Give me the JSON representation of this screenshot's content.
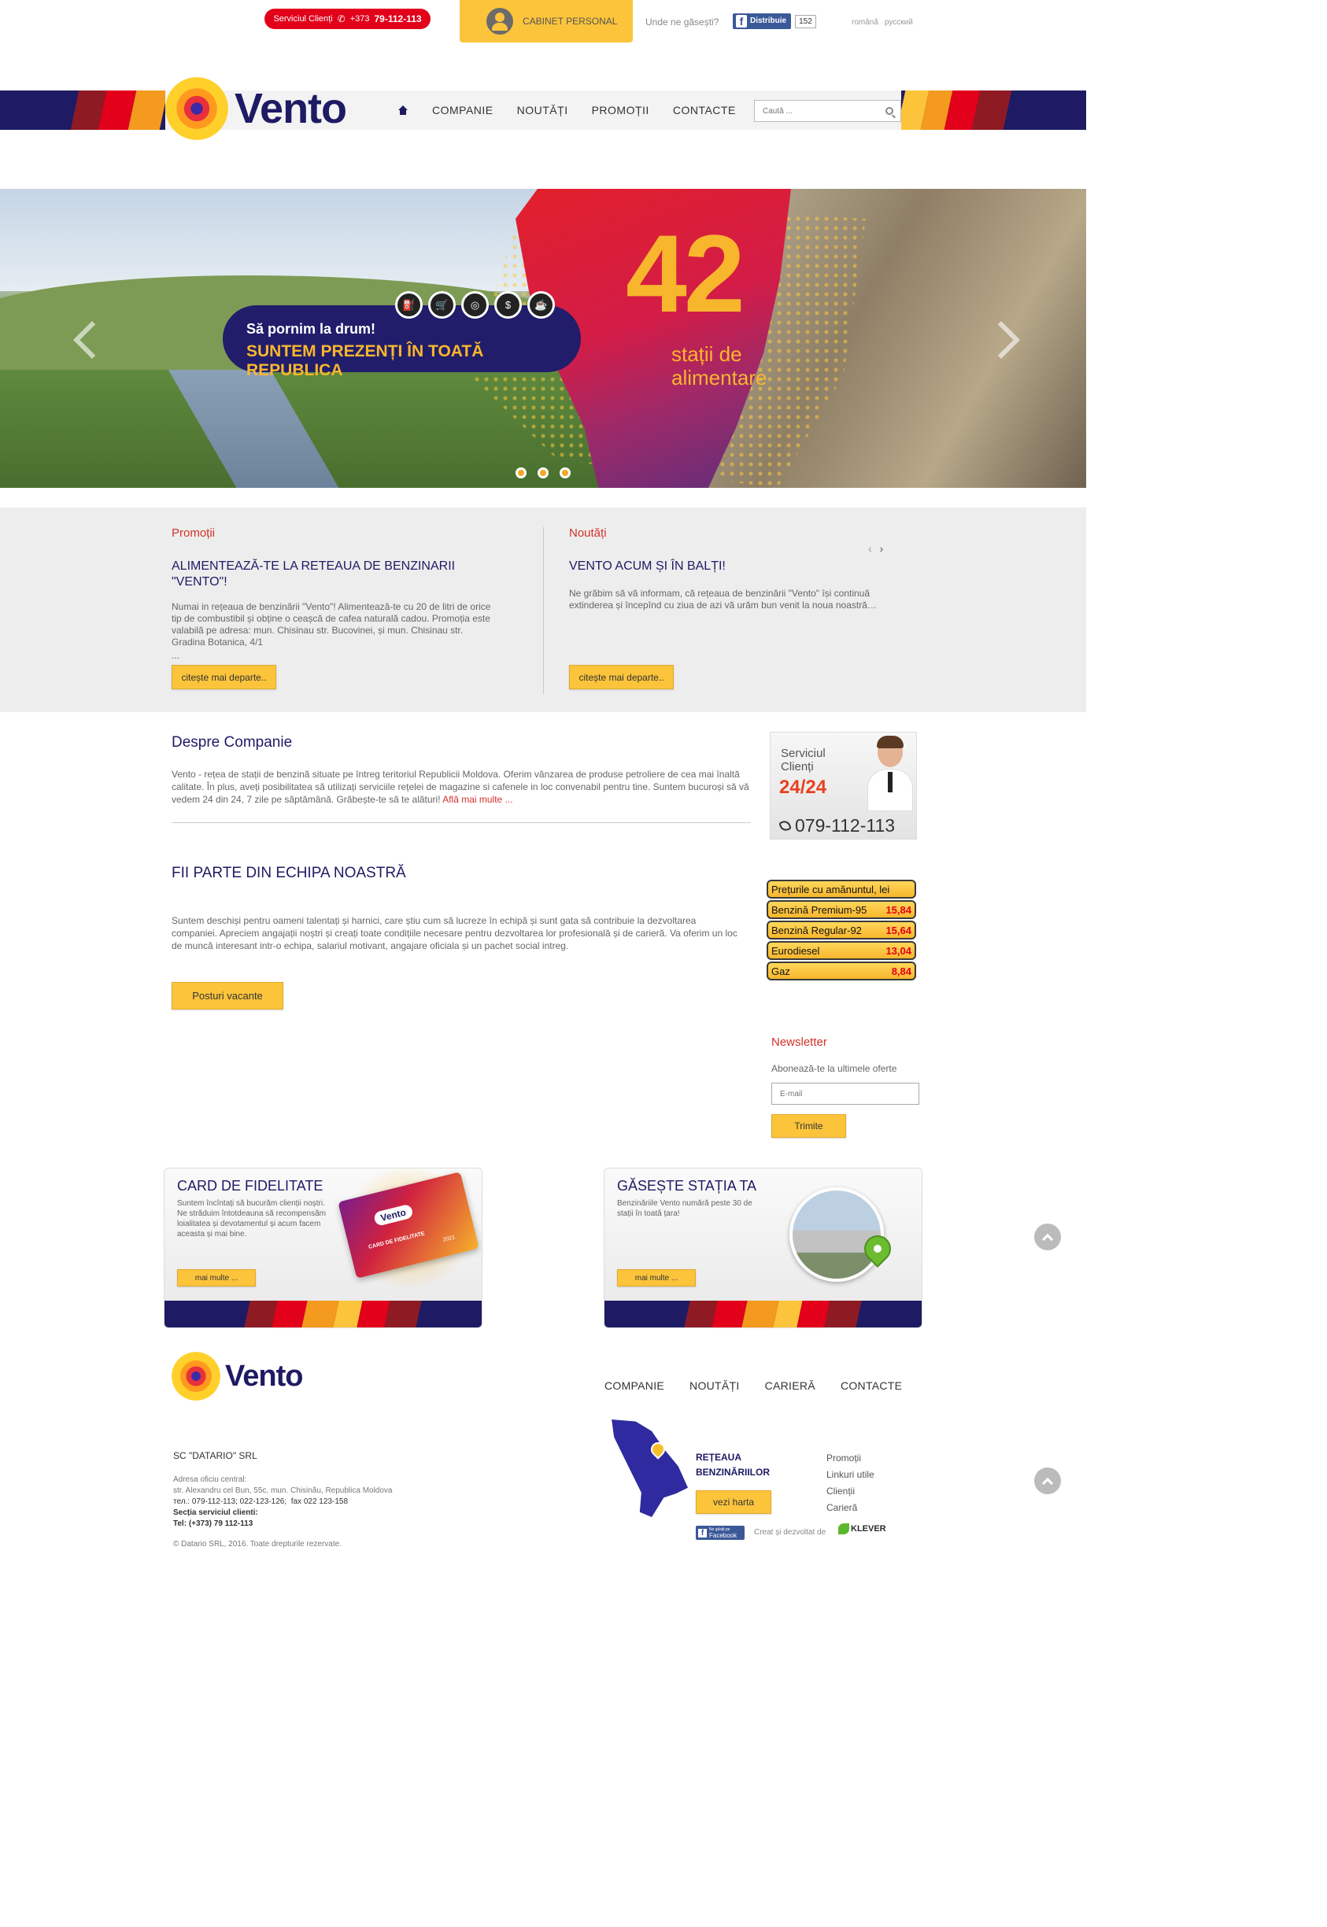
{
  "topbar": {
    "service_label": "Serviciul Clienți",
    "service_phone_prefix": "+373",
    "service_phone": "79-112-113",
    "cabinet_label": "CABINET PERSONAL",
    "find_label": "Unde ne găsești?",
    "fb_label": "Distribuie",
    "fb_count": "152",
    "lang_ro": "română",
    "lang_ru": "русский"
  },
  "nav": {
    "logo_text": "Vento",
    "items": [
      "COMPANIE",
      "NOUTĂȚI",
      "PROMOȚII",
      "CONTACTE"
    ],
    "search_placeholder": "Caută ..."
  },
  "hero": {
    "pill_line1": "Să pornim la drum!",
    "pill_line2": "SUNTEM PREZENȚI ÎN TOATĂ REPUBLICA",
    "big_number": "42",
    "big_sub1": "stații de",
    "big_sub2": "alimentare",
    "slide_count": 3,
    "icons": [
      "fuel-icon",
      "cart-icon",
      "tire-icon",
      "money-icon",
      "cup-icon"
    ]
  },
  "promotii": {
    "heading": "Promoții",
    "title": "ALIMENTEAZĂ-TE LA RETEAUA DE BENZINARII \"VENTO\"!",
    "text": "Numai in rețeaua de benzinării \"Vento\"! Alimentează-te cu 20 de litri de orice tip de combustibil și obține o ceașcă de cafea naturală cadou. Promoția este valabilă pe adresa: mun. Chisinau str. Bucovinei, și mun. Chisinau str. Gradina Botanica, 4/1",
    "ellipsis": "...",
    "button": "citește mai departe.."
  },
  "noutati": {
    "heading": "Noutăți",
    "title": "VENTO ACUM ȘI ÎN BALȚI!",
    "text": "Ne grăbim să vă informam, că rețeaua de benzinării \"Vento\" își continuă extinderea și începînd cu ziua de azi vă urăm bun venit la noua noastră…",
    "button": "citește mai departe.."
  },
  "about": {
    "title": "Despre Companie",
    "text": "Vento - rețea de stații de benzină situate pe întreg teritoriul Republicii Moldova. Oferim vânzarea de produse petroliere de cea mai înaltă calitate. În plus, aveți posibilitatea să utilizați serviciile rețelei de magazine si cafenele in loc convenabil pentru tine. Suntem bucuroși să vă vedem 24 din 24, 7 zile pe săptămână. Grăbește-te să te alături!",
    "more": "Află mai multe ..."
  },
  "team": {
    "title": "FII PARTE DIN ECHIPA NOASTRĂ",
    "text": "Suntem deschiși pentru oameni talentați și harnici, care știu cum să lucreze în echipă și sunt gata să contribuie la dezvoltarea companiei. Apreciem angajații noștri și creați toate condițiile necesare pentru dezvoltarea lor profesională și de carieră. Va oferim un loc de muncă interesant intr-o echipa, salariul motivant, angajare oficiala și un pachet social intreg.",
    "button": "Posturi vacante"
  },
  "service_box": {
    "title1": "Serviciul",
    "title2": "Clienți",
    "hours": "24/24",
    "phone": "079-112-113"
  },
  "prices": {
    "heading": "Prețurile cu amănuntul, lei",
    "rows": [
      {
        "name": "Benzină Premium-95",
        "value": "15,84"
      },
      {
        "name": "Benzină Regular-92",
        "value": "15,64"
      },
      {
        "name": "Eurodiesel",
        "value": "13,04"
      },
      {
        "name": "Gaz",
        "value": "8,84"
      }
    ]
  },
  "newsletter": {
    "title": "Newsletter",
    "subtitle": "Abonează-te la ultimele oferte",
    "placeholder": "E-mail",
    "button": "Trimite"
  },
  "card_fidelitate": {
    "title": "CARD DE FIDELITATE",
    "text": "Suntem încîntați să bucurăm clienții noștri. Ne străduim întotdeauna să recompensăm loialitatea și devotamentul și acum facem aceasta și mai bine.",
    "button": "mai multe ...",
    "card_brand": "Vento",
    "card_label": "CARD DE FIDELITATE",
    "card_year": "2021"
  },
  "gaseste_statia": {
    "title": "GĂSEȘTE STAȚIA TA",
    "text": "Benzinăriile Vento numără peste 30 de stații în toată țara!",
    "button": "mai multe ..."
  },
  "footer": {
    "logo_text": "Vento",
    "nav": [
      "COMPANIE",
      "NOUTĂȚI",
      "CARIERĂ",
      "CONTACTE"
    ],
    "company": "SC \"DATARIO\" SRL",
    "address_label": "Adresa oficiu central:",
    "address": "str. Alexandru cel Bun, 55c, mun. Chisinău, Republica Moldova",
    "phones": "тел.: 079-112-113; 022-123-126;",
    "fax": "fax 022 123-158",
    "svc_label": "Secția serviciul clienti:",
    "svc_phone": "Tel: (+373) 79 112-113",
    "copyright": "© Datario SRL, 2016. Toate drepturile rezervate.",
    "network_line1": "REȚEAUA",
    "network_line2": "BENZINĂRIILOR",
    "map_button": "vezi harta",
    "links": [
      "Promoții",
      "Linkuri utile",
      "Clienții",
      "Carieră"
    ],
    "fb_small": "Facebook",
    "fb_small_sub": "Ne găsiți pe",
    "created_by": "Creat și dezvoltat de",
    "dev_brand": "KLEVER"
  },
  "colors": {
    "brand_navy": "#1e1b64",
    "brand_yellow": "#fcc43b",
    "brand_red": "#e2001a",
    "heading_red": "#d3322a"
  }
}
